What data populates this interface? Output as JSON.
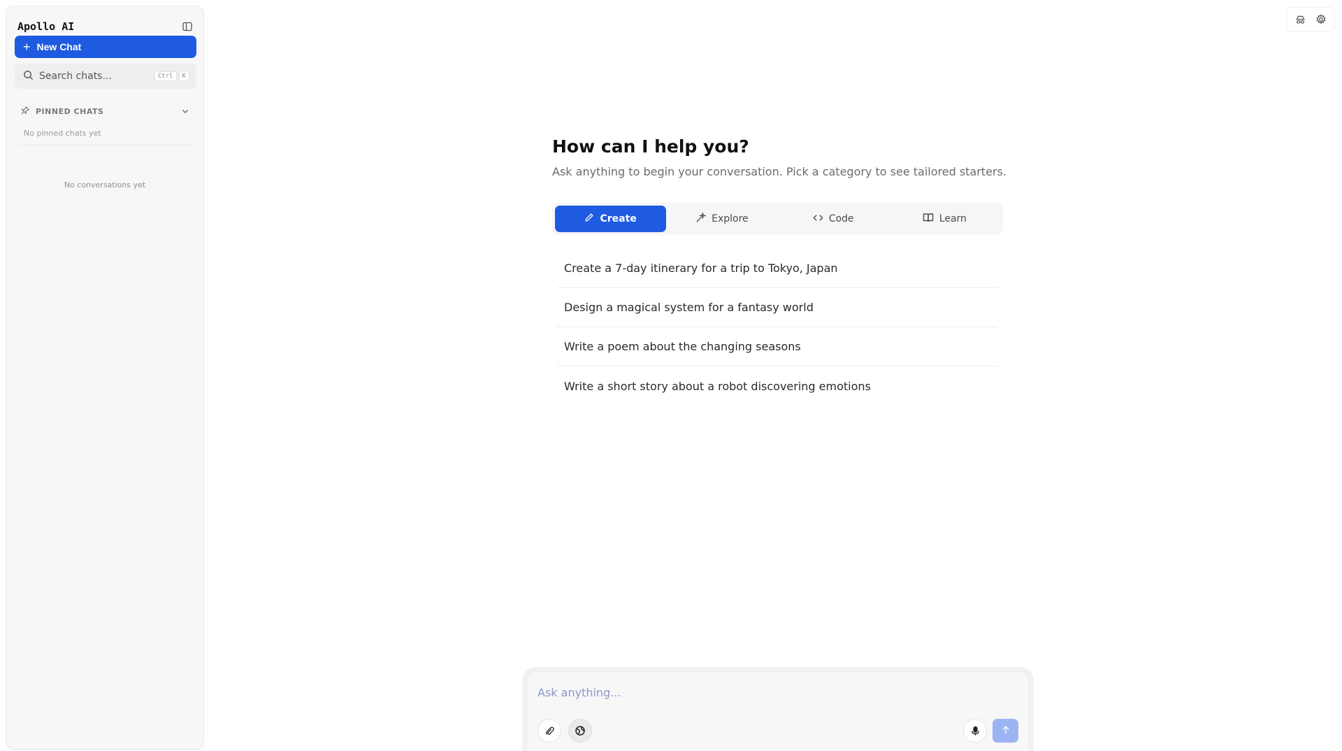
{
  "sidebar": {
    "title": "Apollo AI",
    "new_chat_label": "New Chat",
    "search": {
      "placeholder": "Search chats...",
      "shortcut_ctrl": "Ctrl",
      "shortcut_key": "K"
    },
    "pinned": {
      "label": "PINNED CHATS",
      "empty_text": "No pinned chats yet"
    },
    "empty_conversations": "No conversations yet"
  },
  "main": {
    "title": "How can I help you?",
    "subtitle": "Ask anything to begin your conversation. Pick a category to see tailored starters.",
    "tabs": [
      {
        "label": "Create",
        "icon": "pencil-icon",
        "active": true
      },
      {
        "label": "Explore",
        "icon": "sparkle-icon",
        "active": false
      },
      {
        "label": "Code",
        "icon": "code-icon",
        "active": false
      },
      {
        "label": "Learn",
        "icon": "book-icon",
        "active": false
      }
    ],
    "suggestions": [
      "Create a 7-day itinerary for a trip to Tokyo, Japan",
      "Design a magical system for a fantasy world",
      "Write a poem about the changing seasons",
      "Write a short story about a robot discovering emotions"
    ]
  },
  "composer": {
    "placeholder": "Ask anything...",
    "icons": [
      "attach-icon",
      "globe-icon",
      "microphone-icon",
      "arrow-up-icon"
    ]
  },
  "topbar": {
    "icons": [
      "incognito-icon",
      "gear-icon"
    ]
  },
  "colors": {
    "accent": "#1f5be0",
    "send_disabled": "#9db4f3"
  }
}
